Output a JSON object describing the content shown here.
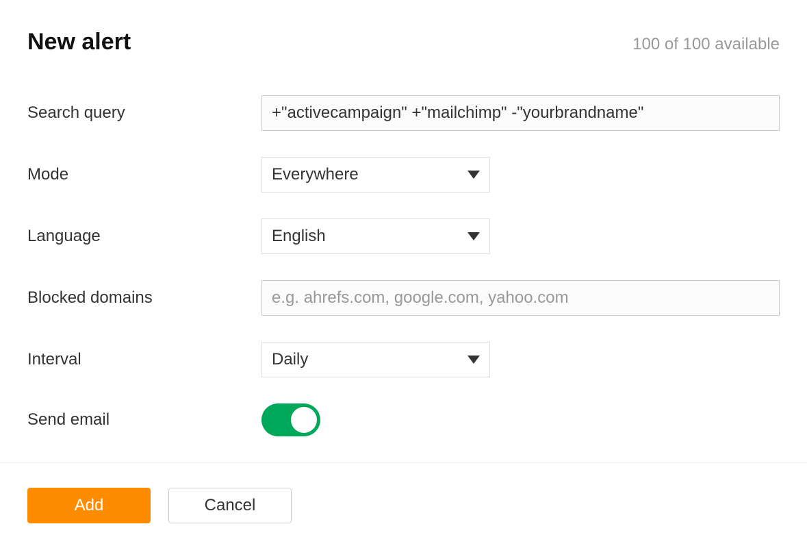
{
  "header": {
    "title": "New alert",
    "quota": "100 of 100 available"
  },
  "form": {
    "search_query": {
      "label": "Search query",
      "value": "+\"activecampaign\" +\"mailchimp\" -\"yourbrandname\""
    },
    "mode": {
      "label": "Mode",
      "value": "Everywhere"
    },
    "language": {
      "label": "Language",
      "value": "English"
    },
    "blocked_domains": {
      "label": "Blocked domains",
      "value": "",
      "placeholder": "e.g. ahrefs.com, google.com, yahoo.com"
    },
    "interval": {
      "label": "Interval",
      "value": "Daily"
    },
    "send_email": {
      "label": "Send email",
      "enabled": true
    }
  },
  "actions": {
    "add": "Add",
    "cancel": "Cancel"
  },
  "colors": {
    "primary": "#ff8c00",
    "toggle_on": "#00a85a"
  }
}
